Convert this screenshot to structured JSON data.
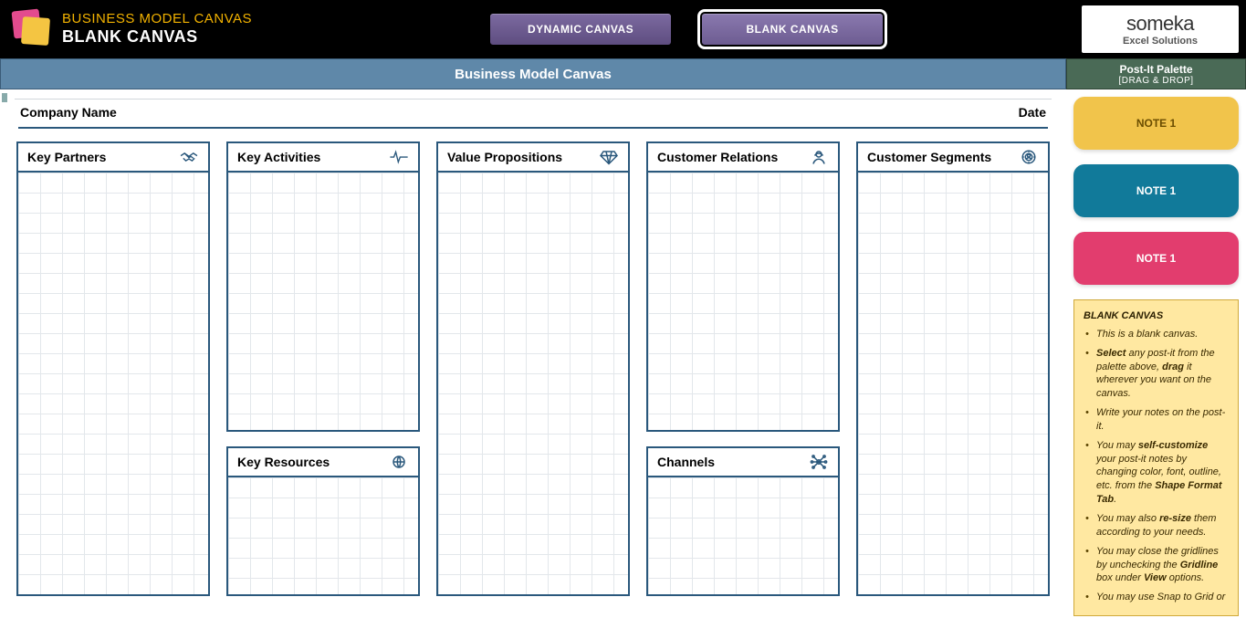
{
  "topbar": {
    "small_title": "BUSINESS MODEL CANVAS",
    "big_title": "BLANK CANVAS",
    "tab_dynamic": "DYNAMIC CANVAS",
    "tab_blank": "BLANK CANVAS",
    "logo_brand": "someka",
    "logo_sub": "Excel Solutions"
  },
  "bluebar": {
    "title": "Business Model Canvas"
  },
  "palette": {
    "line1": "Post-It Palette",
    "line2": "[DRAG & DROP]",
    "note_yellow": "NOTE 1",
    "note_teal": "NOTE 1",
    "note_pink": "NOTE 1"
  },
  "canvas": {
    "company_label": "Company Name",
    "date_label": "Date",
    "cards": {
      "partners": "Key Partners",
      "activities": "Key Activities",
      "resources": "Key Resources",
      "value": "Value Propositions",
      "relations": "Customer Relations",
      "channels": "Channels",
      "segments": "Customer Segments"
    }
  },
  "help": {
    "title": "BLANK CANVAS",
    "b1": "This is a blank canvas.",
    "b2a": "Select",
    "b2b": " any post-it from the palette above, ",
    "b2c": "drag",
    "b2d": " it wherever you want on the canvas.",
    "b3": "Write your notes on the post-it.",
    "b4a": "You may ",
    "b4b": "self-customize",
    "b4c": " your post-it notes by changing color, font, outline, etc. from the ",
    "b4d": "Shape Format Tab",
    "b4e": ".",
    "b5a": "You may also ",
    "b5b": "re-size",
    "b5c": " them according to your needs.",
    "b6a": "You may close the  gridlines by unchecking the ",
    "b6b": "Gridline",
    "b6c": " box under ",
    "b6d": "View",
    "b6e": " options.",
    "b7": "You may use Snap to Grid or"
  }
}
